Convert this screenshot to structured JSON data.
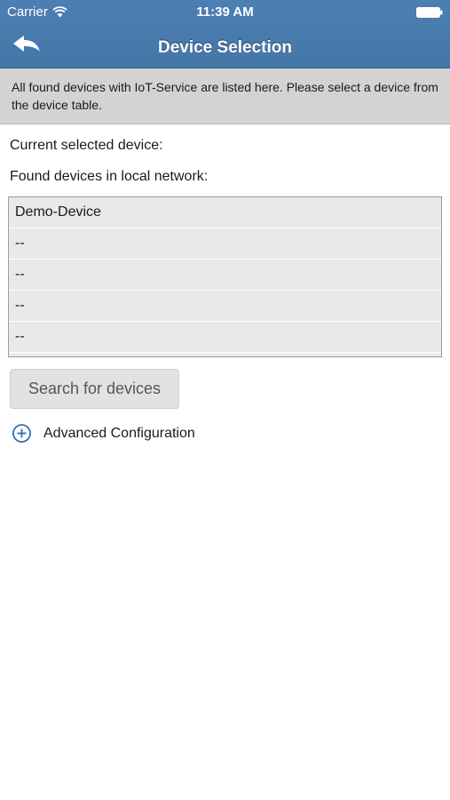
{
  "status_bar": {
    "carrier": "Carrier",
    "time": "11:39 AM",
    "wifi_icon": "wifi-icon",
    "battery_icon": "battery-icon"
  },
  "nav": {
    "title": "Device Selection",
    "back_icon": "back-arrow-icon"
  },
  "info_text": "All found devices with IoT-Service are listed here. Please select a device from the device table.",
  "current_device_label": "Current selected device:",
  "found_devices_label": "Found devices in local network:",
  "devices": [
    "Demo-Device",
    "--",
    "--",
    "--",
    "--"
  ],
  "search_button_label": "Search for devices",
  "advanced": {
    "label": "Advanced Configuration",
    "icon": "plus-circle-icon"
  },
  "colors": {
    "nav_background": "#4a7cae",
    "banner_background": "#d3d3d3",
    "table_row_background": "#e9e9e9",
    "accent": "#2f6fb0"
  }
}
